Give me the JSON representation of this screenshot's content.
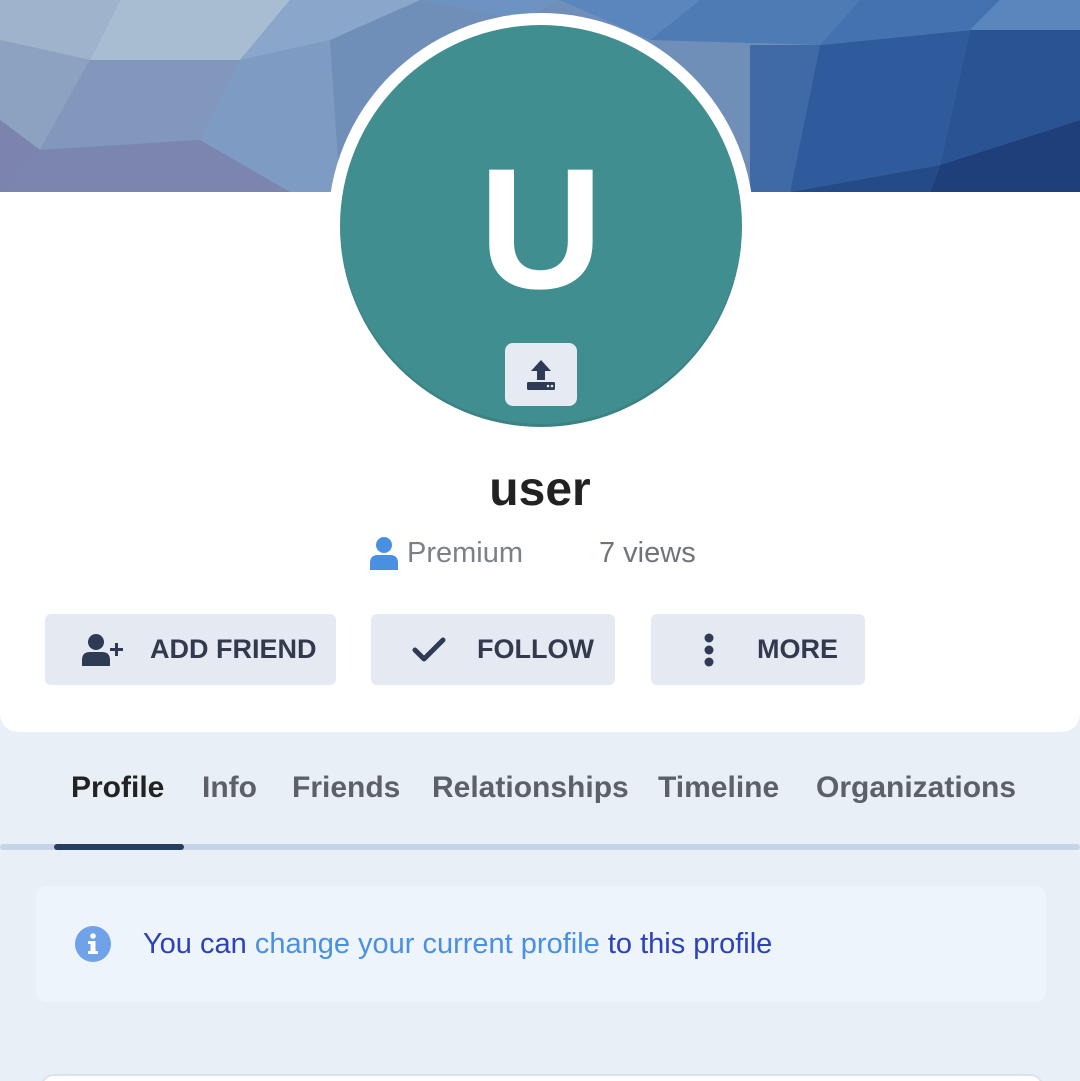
{
  "avatar": {
    "initial": "U",
    "color": "#408e8f",
    "upload_icon": "upload-icon"
  },
  "user": {
    "name": "user",
    "role": "Premium",
    "views": "7 views"
  },
  "actions": {
    "add_friend": "ADD FRIEND",
    "follow": "FOLLOW",
    "more": "MORE"
  },
  "tabs": [
    "Profile",
    "Info",
    "Friends",
    "Relationships",
    "Timeline",
    "Organizations"
  ],
  "active_tab": "Profile",
  "notice": {
    "prefix": "You can ",
    "link": "change your current profile",
    "suffix": " to this profile"
  },
  "colors": {
    "accent": "#4a90e2",
    "notice_text": "#2b42b8",
    "button_bg": "#e5eaf2",
    "tab_indicator": "#263f5c"
  }
}
